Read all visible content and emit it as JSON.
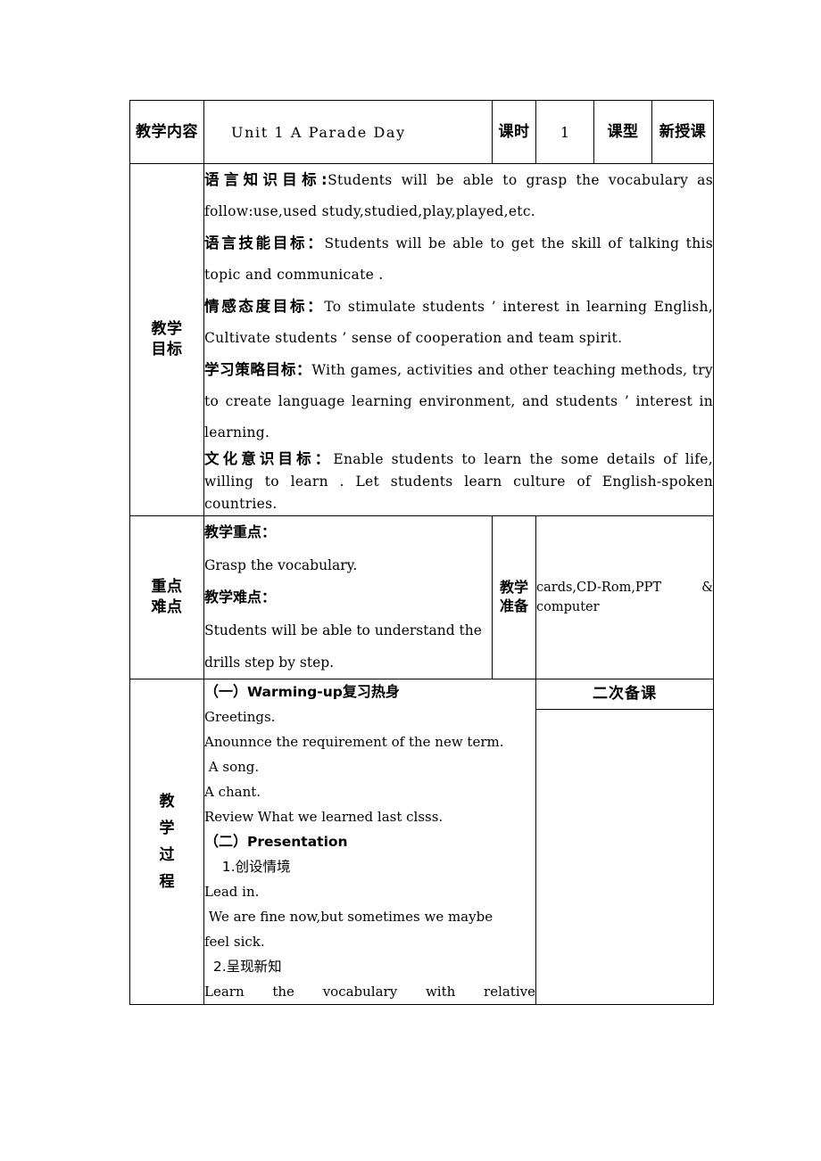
{
  "document": {
    "type": "lesson-plan-table"
  },
  "header_row": {
    "content_label": "教学内容",
    "title": "Unit 1 A Parade Day",
    "period_label": "课时",
    "period_value": "1",
    "type_label": "课型",
    "type_value": "新授课"
  },
  "objectives_row": {
    "label": "教学目标",
    "items": [
      {
        "label": "语言知识目标:",
        "text": "Students will be able to grasp the vocabulary as follow:use,used study,studied,play,played,etc."
      },
      {
        "label": "语言技能目标：",
        "text": "Students will be able to get the  skill of talking this topic and  communicate ."
      },
      {
        "label": "情感态度目标：",
        "text": "To stimulate students ’ interest in learning English, Cultivate students ’ sense of cooperation and team spirit."
      },
      {
        "label": "学习策略目标：",
        "text": "With games, activities and other teaching methods, try to create language learning environment, and students ’ interest in learning."
      },
      {
        "label": "文化意识目标：",
        "text": "Enable students to learn the some details of life, willing to learn . Let students learn culture of English-spoken countries."
      }
    ]
  },
  "key_points_row": {
    "label_line1": "重点",
    "label_line2": "难点",
    "focus_label": "教学重点：",
    "focus_text": "Grasp the vocabulary.",
    "difficulty_label": "教学难点：",
    "difficulty_text": "Students will be able to understand the drills step by step.",
    "prep_label_line1": "教学",
    "prep_label_line2": "准备",
    "prep_text_line1": "cards,CD-Rom,PPT &",
    "prep_text_line2": "computer"
  },
  "process_row": {
    "label_chars": [
      "教",
      "学",
      "过",
      "程"
    ],
    "second_prep_header": "二次备课",
    "lines": [
      {
        "style": "heading",
        "cn": "（一）",
        "text": "Warming-up",
        "cn2": "复习热身"
      },
      {
        "style": "plain",
        "text": "Greetings."
      },
      {
        "style": "plain",
        "text": "Anounnce the requirement of the new term."
      },
      {
        "style": "plain",
        "text": " A song."
      },
      {
        "style": "plain",
        "text": "A chant."
      },
      {
        "style": "plain",
        "text": "Review What we learned last clsss."
      },
      {
        "style": "heading",
        "cn": "（二）",
        "text": "Presentation",
        "cn2": ""
      },
      {
        "style": "cn-indent",
        "text": "    1.创设情境"
      },
      {
        "style": "plain",
        "text": "Lead in."
      },
      {
        "style": "plain",
        "text": " We are fine now,but sometimes we maybe"
      },
      {
        "style": "plain",
        "text": "feel sick."
      },
      {
        "style": "cn-indent",
        "text": "  2.呈现新知"
      },
      {
        "style": "justify",
        "text": "Learn the vocabulary with relative"
      }
    ]
  }
}
